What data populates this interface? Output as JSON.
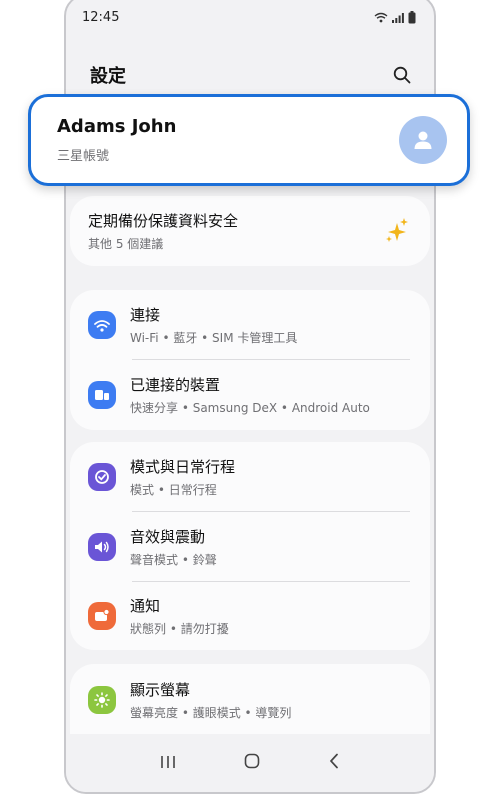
{
  "status": {
    "time": "12:45"
  },
  "header": {
    "title": "設定"
  },
  "account": {
    "name": "Adams John",
    "subtitle": "三星帳號"
  },
  "suggestion": {
    "title": "定期備份保護資料安全",
    "subtitle": "其他 5 個建議"
  },
  "groups": [
    [
      {
        "icon": "wifi-icon",
        "color": "#3d7cf2",
        "title": "連接",
        "subtitle": "Wi-Fi • 藍牙 • SIM 卡管理工具"
      },
      {
        "icon": "devices-icon",
        "color": "#3d7cf2",
        "title": "已連接的裝置",
        "subtitle": "快速分享 • Samsung DeX • Android Auto"
      }
    ],
    [
      {
        "icon": "modes-icon",
        "color": "#6a55d6",
        "title": "模式與日常行程",
        "subtitle": "模式 • 日常行程"
      },
      {
        "icon": "sound-icon",
        "color": "#6a55d6",
        "title": "音效與震動",
        "subtitle": "聲音模式 • 鈴聲"
      },
      {
        "icon": "notification-icon",
        "color": "#ef6a3a",
        "title": "通知",
        "subtitle": "狀態列 • 請勿打擾"
      }
    ],
    [
      {
        "icon": "display-icon",
        "color": "#8cc63f",
        "title": "顯示螢幕",
        "subtitle": "螢幕亮度 • 護眼模式 • 導覽列"
      }
    ]
  ],
  "colors": {
    "accent": "#1b6fd8",
    "avatar_bg": "#a8c4f0",
    "sparkle": "#f2b51b"
  }
}
